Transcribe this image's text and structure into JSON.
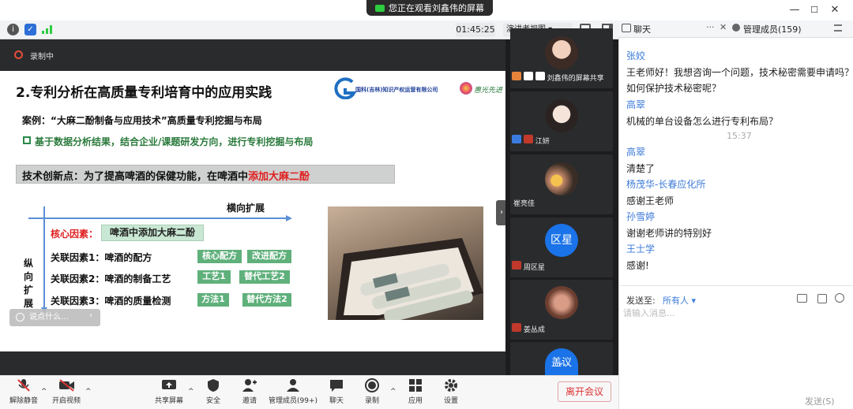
{
  "window": {
    "share_banner": "您正在观看刘鑫伟的屏幕",
    "min": "—",
    "max": "☐",
    "close": "✕"
  },
  "topbar": {
    "timer": "01:45:25",
    "view_mode": "演讲者视图 ▾",
    "recording": "录制中"
  },
  "slide": {
    "title": "2.专利分析在高质量专利培育中的应用实践",
    "logo_text": "国科(吉林)知识产权运营有限公司",
    "logo2_text": "惠光先进",
    "case": "案例：“大麻二酚制备与应用技术”高质量专利挖掘与布局",
    "bullet": "基于数据分析结果，结合企业/课题研发方向，进行专利挖掘与布局",
    "innovation_prefix": "技术创新点：为了提高啤酒的保健功能，在啤酒中",
    "innovation_highlight": "添加大麻二酚",
    "horizontal": "横向扩展",
    "vertical": "纵向扩展",
    "core_label": "核心因素：",
    "core_value": "啤酒中添加大麻二酚",
    "factors": [
      {
        "label": "关联因素1：啤酒的配方",
        "a": "核心配方",
        "b": "改进配方"
      },
      {
        "label": "关联因素2：啤酒的制备工艺",
        "a": "工艺1",
        "b": "替代工艺2"
      },
      {
        "label": "关联因素3：啤酒的质量检测",
        "a": "方法1",
        "b": "替代方法2"
      }
    ],
    "say_something": "说点什么..."
  },
  "participants": [
    {
      "name": "刘鑫伟的屏幕共享",
      "avatar_text": ""
    },
    {
      "name": "江妍",
      "avatar_text": ""
    },
    {
      "name": "崔亮佳",
      "avatar_text": ""
    },
    {
      "name": "周区星",
      "avatar_text": "区星"
    },
    {
      "name": "姜丛成",
      "avatar_text": ""
    },
    {
      "name": "",
      "avatar_text": "盖议"
    }
  ],
  "chat": {
    "tab_chat": "聊天",
    "tab_members": "管理成员(159)",
    "more": "···",
    "close": "✕",
    "messages": [
      {
        "type": "name",
        "text": "张姣"
      },
      {
        "type": "msg",
        "text": "王老师好！我想咨询一个问题，技术秘密需要申请吗？"
      },
      {
        "type": "msg",
        "text": "如何保护技术秘密呢？"
      },
      {
        "type": "name",
        "text": "高翠"
      },
      {
        "type": "msg",
        "text": "机械的单台设备怎么进行专利布局？"
      },
      {
        "type": "time",
        "text": "15:37"
      },
      {
        "type": "name",
        "text": "高翠"
      },
      {
        "type": "msg",
        "text": "清楚了"
      },
      {
        "type": "name",
        "text": "杨茂华-长春应化所"
      },
      {
        "type": "msg",
        "text": "感谢王老师"
      },
      {
        "type": "name",
        "text": "孙雪婷"
      },
      {
        "type": "msg",
        "text": "谢谢老师讲的特别好"
      },
      {
        "type": "name",
        "text": "王士学"
      },
      {
        "type": "msg",
        "text": "感谢!"
      }
    ],
    "send_to_label": "发送至:",
    "send_to_value": "所有人 ▾",
    "input_placeholder": "请输入消息...",
    "send_button": "发送(S)"
  },
  "toolbar": {
    "unmute": "解除静音",
    "video": "开启视频",
    "share": "共享屏幕",
    "security": "安全",
    "invite": "邀请",
    "members": "管理成员(99+)",
    "chat": "聊天",
    "record": "录制",
    "apps": "应用",
    "settings": "设置",
    "leave": "离开会议"
  },
  "colors": {
    "accent_blue": "#3d7bd9",
    "slide_green": "#5fb07b",
    "highlight_red": "#e02020",
    "avatar_blue": "#1a73e8"
  }
}
